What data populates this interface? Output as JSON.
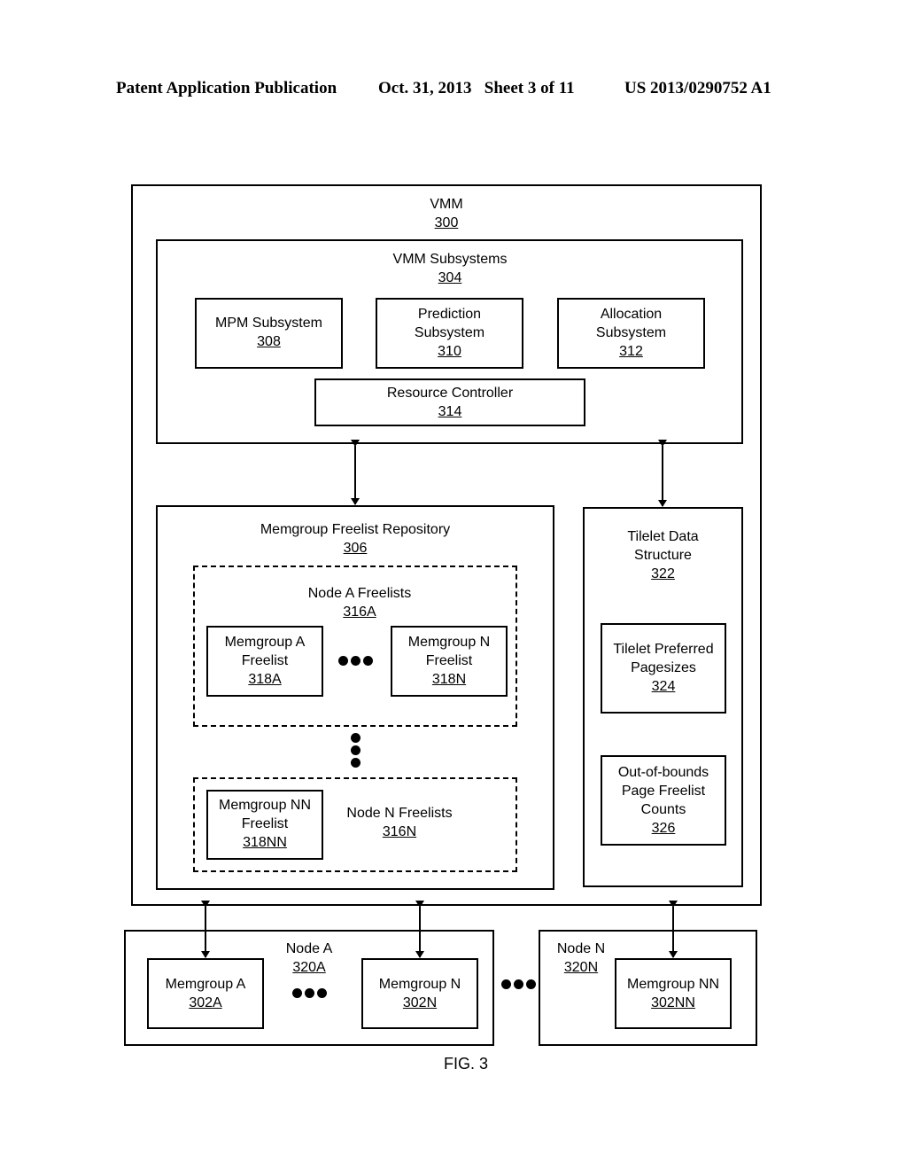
{
  "header": {
    "left": "Patent Application Publication",
    "middle": "Oct. 31, 2013   Sheet 3 of 11",
    "right": "US 2013/0290752 A1"
  },
  "vmm": {
    "title": "VMM",
    "ref": "300"
  },
  "subsystems": {
    "title": "VMM Subsystems",
    "ref": "304"
  },
  "mpm": {
    "line1": "MPM Subsystem",
    "ref": "308"
  },
  "prediction": {
    "line1": "Prediction",
    "line2": "Subsystem",
    "ref": "310"
  },
  "allocation": {
    "line1": "Allocation",
    "line2": "Subsystem",
    "ref": "312"
  },
  "resource_controller": {
    "line1": "Resource Controller",
    "ref": "314"
  },
  "repository": {
    "title": "Memgroup Freelist Repository",
    "ref": "306"
  },
  "node_a_freelists": {
    "title": "Node A Freelists",
    "ref": "316A"
  },
  "memgroup_a_freelist": {
    "line1": "Memgroup A",
    "line2": "Freelist",
    "ref": "318A"
  },
  "memgroup_n_freelist": {
    "line1": "Memgroup N",
    "line2": "Freelist",
    "ref": "318N"
  },
  "node_n_freelists": {
    "title": "Node N Freelists",
    "ref": "316N"
  },
  "memgroup_nn_freelist": {
    "line1": "Memgroup NN",
    "line2": "Freelist",
    "ref": "318NN"
  },
  "tilelet": {
    "line1": "Tilelet Data",
    "line2": "Structure",
    "ref": "322"
  },
  "preferred_pagesizes": {
    "line1": "Tilelet Preferred",
    "line2": "Pagesizes",
    "ref": "324"
  },
  "oob_counts": {
    "line1": "Out-of-bounds",
    "line2": "Page Freelist",
    "line3": "Counts",
    "ref": "326"
  },
  "node_a": {
    "title": "Node A",
    "ref": "320A"
  },
  "memgroup_a": {
    "line1": "Memgroup A",
    "ref": "302A"
  },
  "memgroup_n": {
    "line1": "Memgroup N",
    "ref": "302N"
  },
  "node_n": {
    "title": "Node N",
    "ref": "320N"
  },
  "memgroup_nn": {
    "line1": "Memgroup NN",
    "ref": "302NN"
  },
  "figure_caption": "FIG. 3"
}
